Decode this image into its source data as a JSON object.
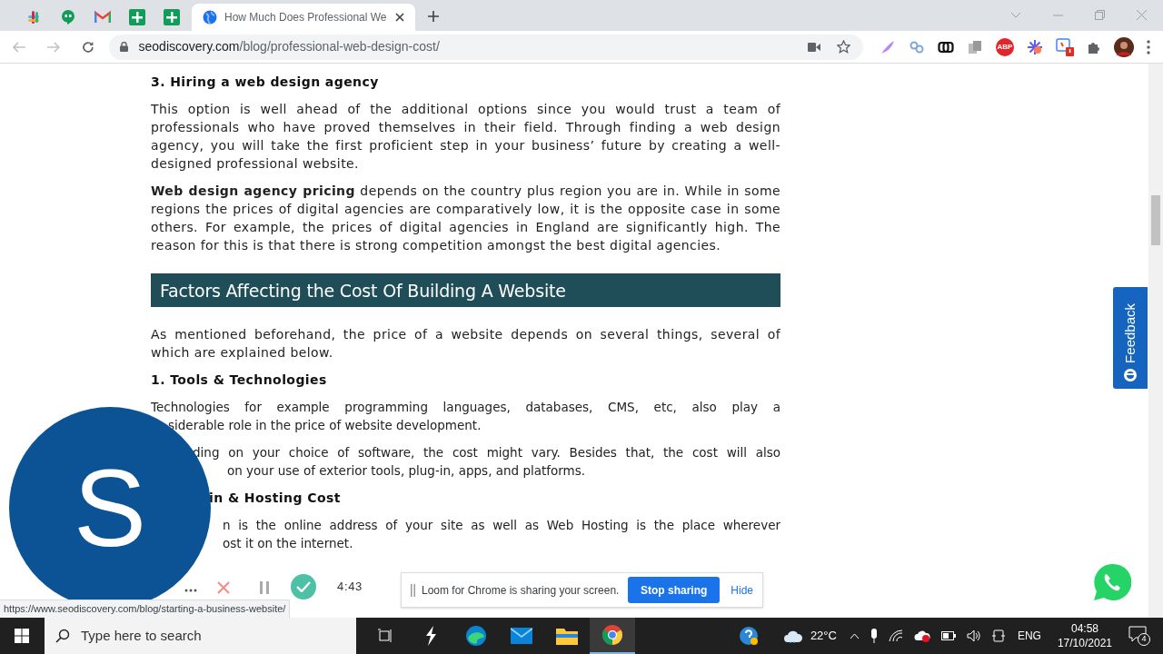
{
  "browser": {
    "tabs": [
      {
        "kind": "pinned",
        "selected": false
      },
      {
        "kind": "pinned",
        "selected": false
      },
      {
        "kind": "pinned",
        "selected": false
      },
      {
        "kind": "pinned",
        "selected": false
      },
      {
        "kind": "pinned",
        "selected": false
      },
      {
        "kind": "page",
        "title": "How Much Does Professional We",
        "selected": true
      }
    ],
    "address": {
      "host": "seodiscovery.com",
      "path": "/blog/professional-web-design-cost/"
    },
    "extension_badge": "ABP"
  },
  "article": [
    {
      "kind": "heading",
      "text": "3. Hiring a web design agency"
    },
    {
      "kind": "paragraph",
      "text": "This option is well ahead of the additional options since you would trust a team of professionals who have proved themselves in their field. Through finding a web design agency, you will take the first proficient step in your business’ future by creating a well-designed professional website."
    },
    {
      "kind": "paragraph",
      "text": "**Web design agency pricing** depends on the country plus region you are in. While in some regions the prices of digital agencies are comparatively low, it is the opposite case in some others. For example, the prices of digital agencies in England are significantly high. The reason for this is that there is strong competition amongst the best digital agencies."
    },
    {
      "kind": "banner",
      "text": "Factors Affecting the Cost Of Building A Website"
    },
    {
      "kind": "paragraph",
      "text": "As mentioned beforehand, the price of a website depends on several things, several of which are explained below."
    },
    {
      "kind": "heading",
      "text": "1. Tools & Technologies"
    },
    {
      "kind": "covered",
      "lines": [
        "Technologies for example programming languages, databases, CMS, etc, also play a",
        "siderable role in the price of website development."
      ]
    },
    {
      "kind": "covered",
      "lines": [
        "ding on your choice of software, the cost might vary. Besides that, the cost will also",
        "on your use of exterior tools, plug-in, apps, and platforms."
      ]
    },
    {
      "kind": "covered_heading",
      "text": "in & Hosting Cost"
    },
    {
      "kind": "covered",
      "lines": [
        "n is the online address of your site as well as Web Hosting is the place wherever",
        "ost it on the internet."
      ]
    }
  ],
  "feedback_tab": "Feedback",
  "status_url": "https://www.seodiscovery.com/blog/starting-a-business-website/",
  "recorder": {
    "avatar_letter": "S",
    "timer": "4:43",
    "notice": "Loom for Chrome is sharing your screen.",
    "stop_button": "Stop sharing",
    "hide_link": "Hide"
  },
  "taskbar": {
    "search_placeholder": "Type here to search",
    "temperature": "22°C",
    "language": "ENG",
    "time": "04:58",
    "date": "17/10/2021",
    "notifications": "4"
  }
}
